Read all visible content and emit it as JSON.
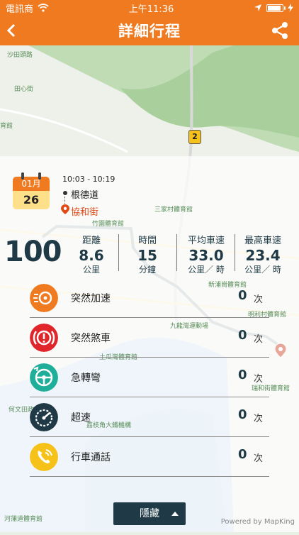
{
  "status_bar": {
    "carrier": "電訊商",
    "time": "上午11:36"
  },
  "header": {
    "title": "詳細行程"
  },
  "map": {
    "labels": [
      "田心街",
      "育館",
      "沙田頭路",
      "三家村體育館",
      "竹園體育館",
      "新浦崗體育館",
      "九龍灣運動場",
      "明利村體育館",
      "瑞和街體育館",
      "荔枝角大鐵機構",
      "何文田政府合署",
      "河蒲道體育館",
      "土瓜灣體育館"
    ],
    "road_badge": "2",
    "attribution": "Powered by MapKing"
  },
  "trip": {
    "month": "01月",
    "day": "26",
    "time_range": "10:03 - 10:19",
    "from": "根德道",
    "to": "協和街"
  },
  "score": "100",
  "stats": [
    {
      "label": "距離",
      "value": "8.6",
      "unit": "公里"
    },
    {
      "label": "時間",
      "value": "15",
      "unit": "分鐘"
    },
    {
      "label": "平均車速",
      "value": "33.0",
      "unit": "公里／ 時"
    },
    {
      "label": "最高車速",
      "value": "23.4",
      "unit": "公里／ 時"
    }
  ],
  "events": [
    {
      "name": "突然加速",
      "count": "0",
      "unit": "次",
      "color": "#f07a1f"
    },
    {
      "name": "突然煞車",
      "count": "0",
      "unit": "次",
      "color": "#e0262a"
    },
    {
      "name": "急轉彎",
      "count": "0",
      "unit": "次",
      "color": "#1fae9a"
    },
    {
      "name": "超速",
      "count": "0",
      "unit": "次",
      "color": "#1f3a46"
    },
    {
      "name": "行車通話",
      "count": "0",
      "unit": "次",
      "color": "#f6c21a"
    }
  ],
  "hide_button": "隱藏"
}
